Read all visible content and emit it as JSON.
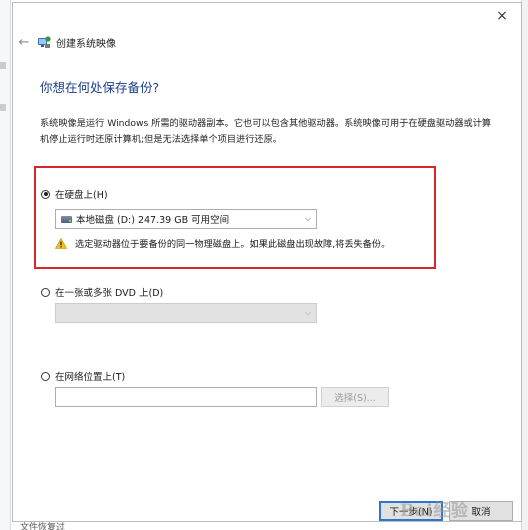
{
  "window": {
    "title": "创建系统映像",
    "close_glyph": "×",
    "back_glyph": "←"
  },
  "heading": "你想在何处保存备份?",
  "description": "系统映像是运行 Windows 所需的驱动器副本。它也可以包含其他驱动器。系统映像可用于在硬盘驱动器或计算机停止运行时还原计算机;但是无法选择单个项目进行还原。",
  "options": {
    "hard_disk": {
      "label": "在硬盘上(H)",
      "selected": true,
      "drive_value": "本地磁盘 (D:)  247.39 GB 可用空间",
      "warning": "选定驱动器位于要备份的同一物理磁盘上。如果此磁盘出现故障,将丢失备份。"
    },
    "dvd": {
      "label": "在一张或多张 DVD 上(D)",
      "selected": false,
      "drive_value": ""
    },
    "network": {
      "label": "在网络位置上(T)",
      "selected": false,
      "path_value": "",
      "select_button": "选择(S)..."
    }
  },
  "buttons": {
    "next": "下一步(N)",
    "cancel": "取消"
  },
  "background": {
    "bottom_text": "文件恢复过"
  },
  "watermark": "Bai经验",
  "colors": {
    "heading": "#1a3d8c",
    "highlight_border": "#d8262b",
    "warning": "#f2c01e",
    "primary_border": "#2f74d0"
  },
  "icons": {
    "app": "system-image-icon",
    "drive": "hard-drive-icon",
    "warning": "warning-triangle-icon"
  }
}
